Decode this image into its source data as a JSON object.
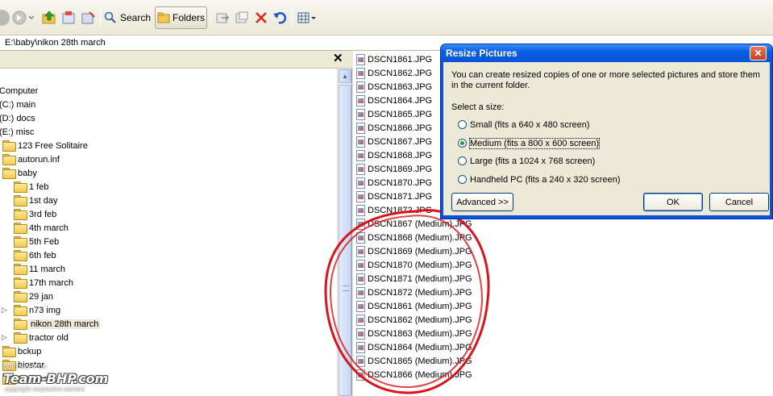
{
  "toolbar": {
    "search_label": "Search",
    "folders_label": "Folders",
    "icons": [
      "back-icon",
      "forward-icon",
      "up-folder-icon",
      "folder-sync-icon",
      "folder-options-icon",
      "search-icon",
      "folders-icon",
      "move-to-icon",
      "copy-to-icon",
      "delete-icon",
      "undo-icon",
      "views-icon"
    ]
  },
  "address": {
    "path": "E:\\baby\\nikon 28th march"
  },
  "folders_pane": {
    "close_glyph": "✕",
    "tree": [
      {
        "label": "Computer",
        "level": 0
      },
      {
        "label": "(C:) main",
        "level": 0
      },
      {
        "label": "(D:) docs",
        "level": 0
      },
      {
        "label": "(E:) misc",
        "level": 0
      },
      {
        "label": "123 Free Solitaire",
        "level": 1
      },
      {
        "label": "autorun.inf",
        "level": 1
      },
      {
        "label": "baby",
        "level": 1
      },
      {
        "label": "1 feb",
        "level": 2
      },
      {
        "label": "1st day",
        "level": 2
      },
      {
        "label": "3rd feb",
        "level": 2
      },
      {
        "label": "4th march",
        "level": 2
      },
      {
        "label": "5th Feb",
        "level": 2
      },
      {
        "label": "6th feb",
        "level": 2
      },
      {
        "label": "11 march",
        "level": 2
      },
      {
        "label": "17th march",
        "level": 2
      },
      {
        "label": "29 jan",
        "level": 2
      },
      {
        "label": "n73 img",
        "level": 2,
        "expander": "▷"
      },
      {
        "label": "nikon 28th march",
        "level": 2,
        "selected": true
      },
      {
        "label": "tractor old",
        "level": 2,
        "expander": "▷"
      },
      {
        "label": "bckup",
        "level": 1
      },
      {
        "label": "biostar",
        "level": 1
      },
      {
        "label": "Convert1",
        "level": 1
      }
    ]
  },
  "file_list": [
    "DSCN1861.JPG",
    "DSCN1862.JPG",
    "DSCN1863.JPG",
    "DSCN1864.JPG",
    "DSCN1865.JPG",
    "DSCN1866.JPG",
    "DSCN1867.JPG",
    "DSCN1868.JPG",
    "DSCN1869.JPG",
    "DSCN1870.JPG",
    "DSCN1871.JPG",
    "DSCN1872.JPG",
    "DSCN1867 (Medium).JPG",
    "DSCN1868 (Medium).JPG",
    "DSCN1869 (Medium).JPG",
    "DSCN1870 (Medium).JPG",
    "DSCN1871 (Medium).JPG",
    "DSCN1872 (Medium).JPG",
    "DSCN1861 (Medium).JPG",
    "DSCN1862 (Medium).JPG",
    "DSCN1863 (Medium).JPG",
    "DSCN1864 (Medium).JPG",
    "DSCN1865 (Medium).JPG",
    "DSCN1866 (Medium).JPG"
  ],
  "dialog": {
    "title": "Resize Pictures",
    "close_glyph": "✕",
    "description": "You can create resized copies of one or more selected pictures and store them in the current folder.",
    "select_label": "Select a size:",
    "options": [
      {
        "label": "Small (fits a 640 x 480 screen)",
        "selected": false
      },
      {
        "label": "Medium (fits a 800 x 600 screen)",
        "selected": true
      },
      {
        "label": "Large (fits a 1024 x 768 screen)",
        "selected": false
      },
      {
        "label": "Handheld PC (fits a 240 x 320 screen)",
        "selected": false
      }
    ],
    "advanced_label": "Advanced >>",
    "ok_label": "OK",
    "cancel_label": "Cancel"
  },
  "annotation_color": "#d8151c",
  "watermark": {
    "brand": "Team-BHP.com",
    "top_text": "COPYRIGHT ON",
    "sub_text": "copyright respective owners"
  }
}
